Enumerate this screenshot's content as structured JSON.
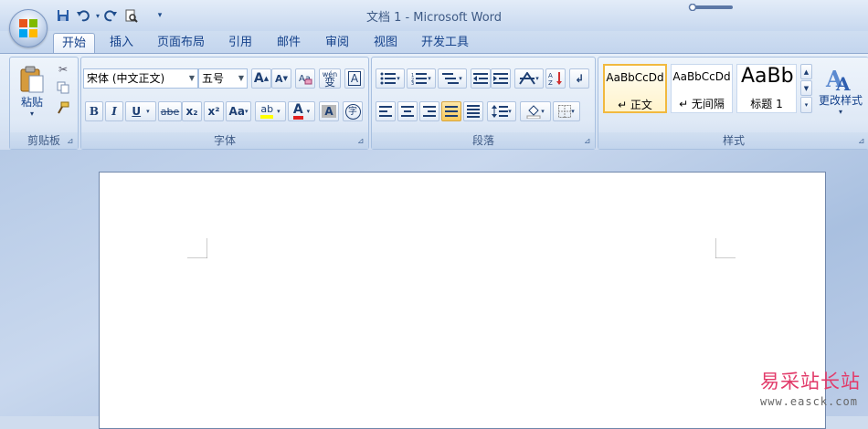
{
  "window": {
    "title": "文档 1 - Microsoft Word"
  },
  "tabs": [
    "开始",
    "插入",
    "页面布局",
    "引用",
    "邮件",
    "审阅",
    "视图",
    "开发工具"
  ],
  "clipboard": {
    "paste_label": "粘贴",
    "group_label": "剪贴板"
  },
  "font": {
    "name": "宋体 (中文正文)",
    "size": "五号",
    "group_label": "字体",
    "bold": "B",
    "italic": "I",
    "underline": "U",
    "strike": "abe",
    "subscript": "x₂",
    "superscript": "x²",
    "case": "Aa",
    "grow": "A",
    "shrink": "A",
    "phonetic": "wén",
    "phonetic_char": "变",
    "border_char": "A",
    "enclose_char": "字",
    "shade_char": "A",
    "color_char": "A",
    "highlight_char": "ab"
  },
  "paragraph": {
    "group_label": "段落"
  },
  "styles": {
    "group_label": "样式",
    "items": [
      {
        "preview": "AaBbCcDd",
        "name": "↵ 正文"
      },
      {
        "preview": "AaBbCcDd",
        "name": "↵ 无间隔"
      },
      {
        "preview": "AaBb",
        "name": "标题 1"
      }
    ],
    "change_label": "更改样式"
  },
  "watermark": {
    "text": "易采站长站",
    "url": "www.easck.com"
  },
  "colors": {
    "accent": "#15428b",
    "highlight": "#ffff00",
    "font_color": "#e02020"
  }
}
